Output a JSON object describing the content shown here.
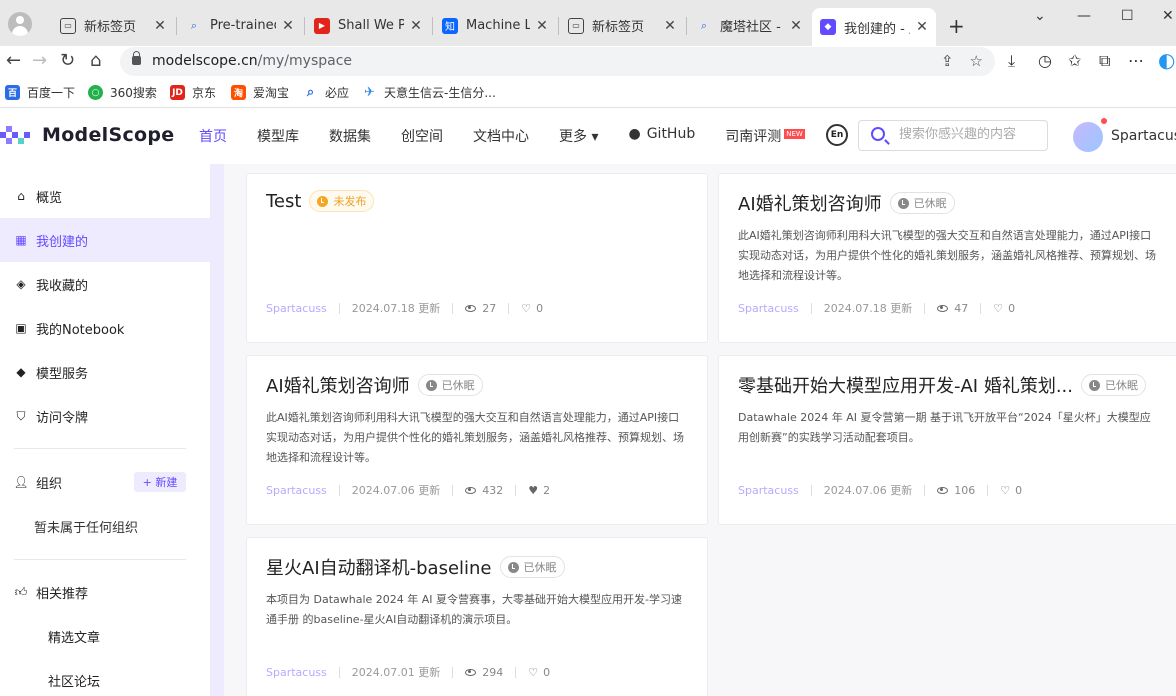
{
  "browser": {
    "tabs": [
      {
        "title": "新标签页",
        "icon": "tab-page-icon"
      },
      {
        "title": "Pre-trained",
        "icon": "search-icon"
      },
      {
        "title": "Shall We Pr",
        "icon": "video-icon"
      },
      {
        "title": "Machine Le",
        "icon": "zhihu-icon"
      },
      {
        "title": "新标签页",
        "icon": "tab-page-icon"
      },
      {
        "title": "魔塔社区 - 搜",
        "icon": "search-icon"
      },
      {
        "title": "我创建的 - 魔",
        "icon": "modelscope-icon"
      }
    ],
    "url_host": "modelscope.cn",
    "url_path": "/my/myspace",
    "bookmarks": [
      {
        "label": "百度一下",
        "color": "#2b6de5"
      },
      {
        "label": "360搜索",
        "color": "#23b14d"
      },
      {
        "label": "京东",
        "color": "#e1251b"
      },
      {
        "label": "爱淘宝",
        "color": "#ff5000"
      },
      {
        "label": "必应",
        "color": "#2b6de5"
      },
      {
        "label": "天意生信云-生信分...",
        "color": "#3a8ee6"
      }
    ]
  },
  "site": {
    "logo": "ModelScope",
    "nav": [
      "首页",
      "模型库",
      "数据集",
      "创空间",
      "文档中心",
      "更多 ▾",
      "GitHub",
      "司南评测"
    ],
    "nav_badge": "NEW",
    "search_placeholder": "搜索你感兴趣的内容",
    "username": "Spartacuss",
    "accent": "#624aff"
  },
  "sidebar": {
    "items": [
      "概览",
      "我创建的",
      "我收藏的",
      "我的Notebook",
      "模型服务",
      "访问令牌"
    ],
    "org_label": "组织",
    "new_label": "+ 新建",
    "org_empty": "暂未属于任何组织",
    "recommend_label": "相关推荐",
    "recommend_items": [
      "精选文章",
      "社区论坛"
    ]
  },
  "cards": [
    {
      "title": "Test",
      "status": "未发布",
      "status_kind": "pending",
      "desc": "",
      "author": "Spartacuss",
      "date": "2024.07.18 更新",
      "views": "27",
      "likes": "0"
    },
    {
      "title": "AI婚礼策划咨询师",
      "status": "已休眠",
      "status_kind": "sleep",
      "desc": "此AI婚礼策划咨询师利用科大讯飞模型的强大交互和自然语言处理能力，通过API接口实现动态对话，为用户提供个性化的婚礼策划服务，涵盖婚礼风格推荐、预算规划、场地选择和流程设计等。",
      "author": "Spartacuss",
      "date": "2024.07.18 更新",
      "views": "47",
      "likes": "0"
    },
    {
      "title": "AI婚礼策划咨询师",
      "status": "已休眠",
      "status_kind": "sleep",
      "desc": "此AI婚礼策划咨询师利用科大讯飞模型的强大交互和自然语言处理能力，通过API接口实现动态对话，为用户提供个性化的婚礼策划服务，涵盖婚礼风格推荐、预算规划、场地选择和流程设计等。",
      "author": "Spartacuss",
      "date": "2024.07.06 更新",
      "views": "432",
      "likes": "2"
    },
    {
      "title": "零基础开始大模型应用开发-AI 婚礼策划...",
      "status": "已休眠",
      "status_kind": "sleep",
      "desc": "Datawhale 2024 年 AI 夏令营第一期 基于讯飞开放平台“2024「星火杯」大模型应用创新赛”的实践学习活动配套项目。",
      "author": "Spartacuss",
      "date": "2024.07.06 更新",
      "views": "106",
      "likes": "0"
    },
    {
      "title": "星火AI自动翻译机-baseline",
      "status": "已休眠",
      "status_kind": "sleep",
      "desc": "本项目为 Datawhale 2024 年 AI 夏令营赛事，大零基础开始大模型应用开发-学习速通手册 的baseline-星火AI自动翻译机的演示项目。",
      "author": "Spartacuss",
      "date": "2024.07.01 更新",
      "views": "294",
      "likes": "0"
    }
  ]
}
